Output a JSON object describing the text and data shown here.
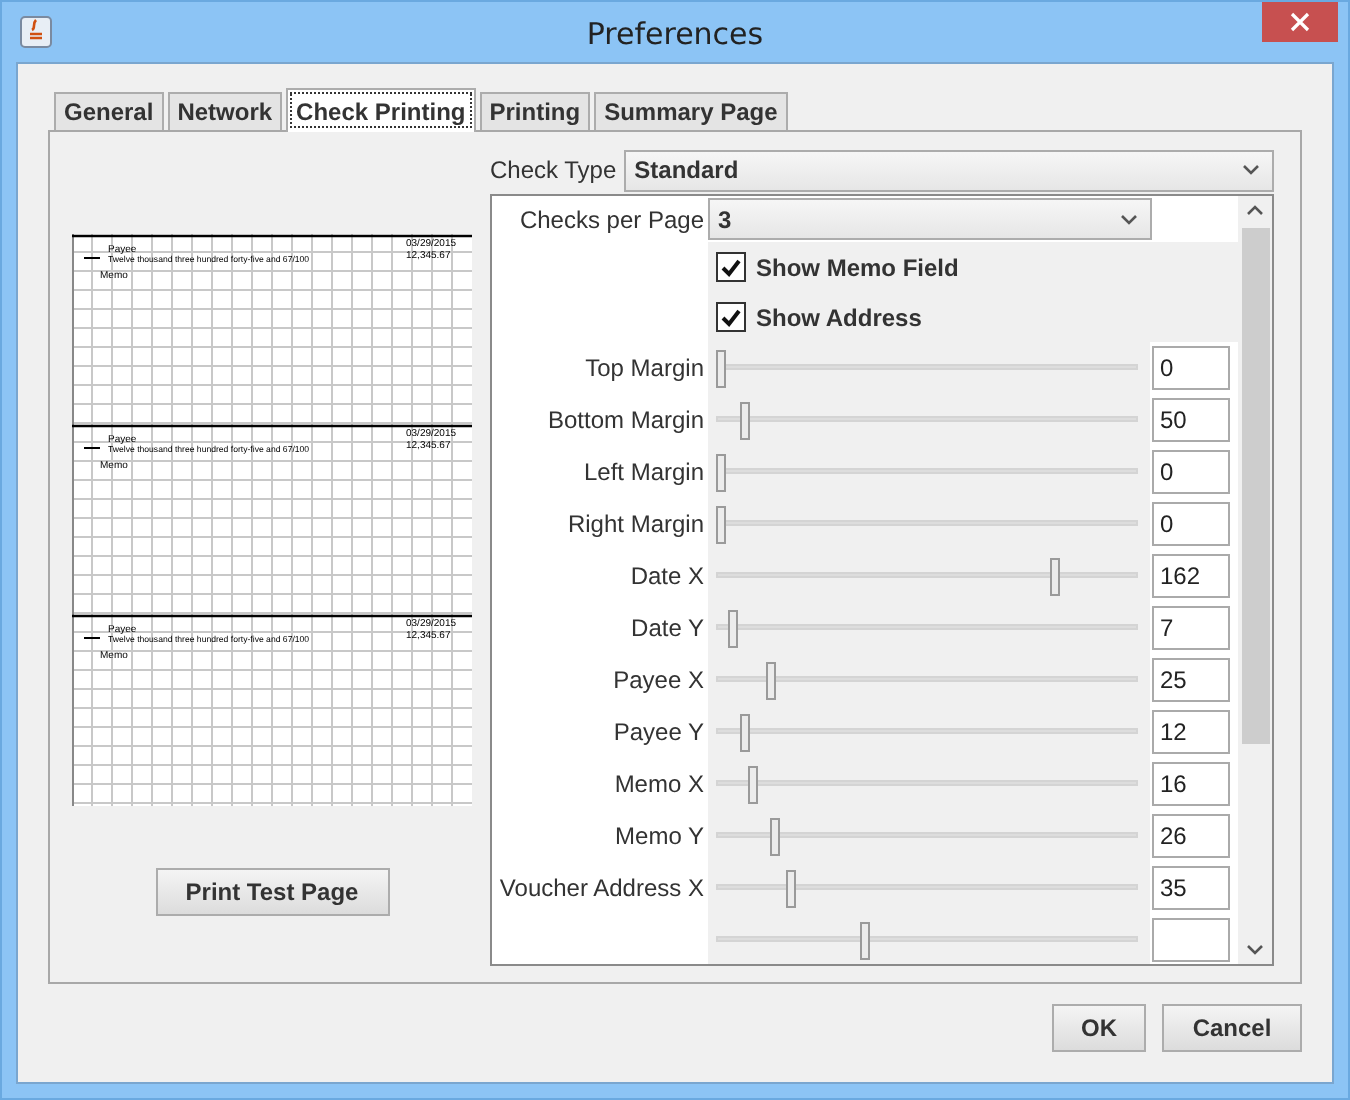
{
  "window": {
    "title": "Preferences"
  },
  "tabs": [
    {
      "label": "General",
      "selected": false
    },
    {
      "label": "Network",
      "selected": false
    },
    {
      "label": "Check Printing",
      "selected": true
    },
    {
      "label": "Printing",
      "selected": false
    },
    {
      "label": "Summary Page",
      "selected": false
    }
  ],
  "preview": {
    "checks": [
      {
        "payee_label": "Payee",
        "amount_words": "Twelve thousand three hundred forty-five and 67/100",
        "date": "03/29/2015",
        "amount": "12,345.67",
        "memo_label": "Memo"
      },
      {
        "payee_label": "Payee",
        "amount_words": "Twelve thousand three hundred forty-five and 67/100",
        "date": "03/29/2015",
        "amount": "12,345.67",
        "memo_label": "Memo"
      },
      {
        "payee_label": "Payee",
        "amount_words": "Twelve thousand three hundred forty-five and 67/100",
        "date": "03/29/2015",
        "amount": "12,345.67",
        "memo_label": "Memo"
      }
    ],
    "button": "Print Test Page"
  },
  "check_type": {
    "label": "Check Type",
    "value": "Standard"
  },
  "settings": [
    {
      "kind": "combo",
      "label": "Checks per Page",
      "value": "3"
    },
    {
      "kind": "checkbox",
      "label": "Show Memo Field",
      "checked": true
    },
    {
      "kind": "checkbox",
      "label": "Show Address",
      "checked": true
    },
    {
      "kind": "slider",
      "label": "Top Margin",
      "level": 0,
      "value": "0"
    },
    {
      "kind": "slider",
      "label": "Bottom Margin",
      "level": 0.06,
      "value": "50"
    },
    {
      "kind": "slider",
      "label": "Left Margin",
      "level": 0,
      "value": "0"
    },
    {
      "kind": "slider",
      "label": "Right Margin",
      "level": 0,
      "value": "0"
    },
    {
      "kind": "slider",
      "label": "Date X",
      "level": 0.81,
      "value": "162"
    },
    {
      "kind": "slider",
      "label": "Date Y",
      "level": 0.03,
      "value": "7"
    },
    {
      "kind": "slider",
      "label": "Payee X",
      "level": 0.12,
      "value": "25"
    },
    {
      "kind": "slider",
      "label": "Payee Y",
      "level": 0.06,
      "value": "12"
    },
    {
      "kind": "slider",
      "label": "Memo X",
      "level": 0.08,
      "value": "16"
    },
    {
      "kind": "slider",
      "label": "Memo Y",
      "level": 0.13,
      "value": "26"
    },
    {
      "kind": "slider",
      "label": "Voucher Address X",
      "level": 0.17,
      "value": "35"
    },
    {
      "kind": "slider",
      "level": 0.35
    }
  ],
  "buttons": [
    "OK",
    "Cancel"
  ]
}
